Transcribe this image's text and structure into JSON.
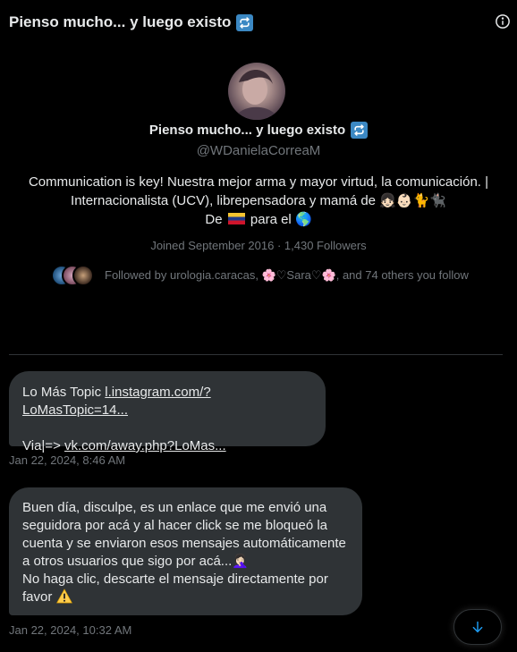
{
  "header": {
    "title": "Pienso mucho... y luego existo"
  },
  "profile": {
    "name": "Pienso mucho... y luego existo",
    "handle": "@WDanielaCorreaM",
    "bio_line1": "Communication is key! Nuestra mejor arma y mayor virtud, la comunicación. |",
    "bio_line2": "Internacionalista (UCV), librepensadora y mamá de",
    "bio_line3_a": "De",
    "bio_line3_b": "para el",
    "meta": "Joined September 2016 · 1,430 Followers",
    "followed_by": "Followed by urologia.caracas, 🌸♡Sara♡🌸, and 74 others you follow"
  },
  "messages": [
    {
      "line1_prefix": "Lo Más Topic ",
      "line1_link": "l.instagram.com/?LoMasTopic=14...",
      "line2_prefix": "Via|=> ",
      "line2_link": "vk.com/away.php?LoMas...",
      "timestamp": "Jan 22, 2024, 8:46 AM"
    },
    {
      "line1": "Buen día, disculpe, es un enlace que me envió una",
      "line2": "seguidora por acá y al hacer click se me bloqueó la",
      "line3": "cuenta y se enviaron esos mensajes automáticamente",
      "line4": "a otros usuarios que sigo por acá...",
      "line4_emoji": "🤦🏻‍♀️",
      "line5": "No haga clic, descarte el mensaje directamente por",
      "line6": "favor",
      "timestamp": "Jan 22, 2024, 10:32 AM"
    }
  ],
  "icons": {
    "info": "info-icon",
    "scroll_down": "arrow-down-icon"
  },
  "colors": {
    "accent": "#1d9bf0",
    "bubble": "#2f3336",
    "muted": "#71767b"
  }
}
